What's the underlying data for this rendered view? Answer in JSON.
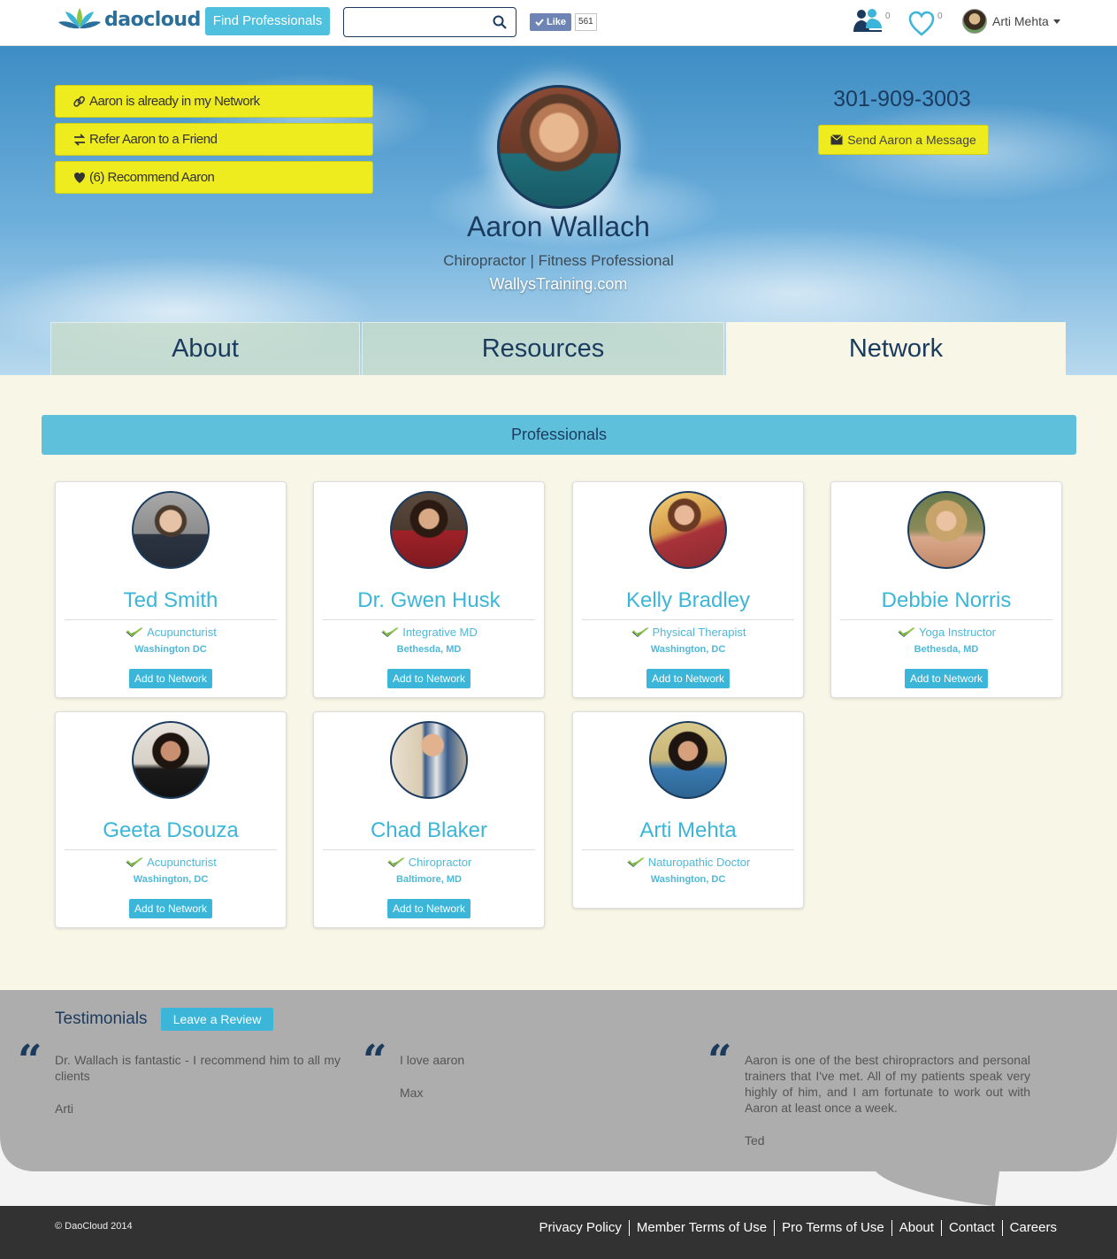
{
  "nav": {
    "logo_text": "daocloud",
    "find_label": "Find Professionals",
    "search_placeholder": "",
    "fb_like_label": "Like",
    "fb_like_count": "561",
    "network_count": "0",
    "favorites_count": "0",
    "user_name": "Arti Mehta"
  },
  "hero": {
    "actions": [
      {
        "label": "Aaron is already in my Network",
        "icon": "link-icon"
      },
      {
        "label": "Refer Aaron to a Friend",
        "icon": "exchange-icon"
      },
      {
        "label": "(6) Recommend Aaron",
        "icon": "heart-icon"
      }
    ],
    "name": "Aaron Wallach",
    "title": "Chiropractor | Fitness Professional",
    "website": "WallysTraining.com",
    "phone": "301-909-3003",
    "message_label": "Send Aaron a Message"
  },
  "tabs": [
    {
      "label": "About",
      "active": false
    },
    {
      "label": "Resources",
      "active": false
    },
    {
      "label": "Network",
      "active": true
    }
  ],
  "professionals": {
    "heading": "Professionals",
    "add_label": "Add to Network",
    "items": [
      {
        "name": "Ted Smith",
        "specialty": "Acupuncturist",
        "location": "Washington DC",
        "can_add": true
      },
      {
        "name": "Dr. Gwen Husk",
        "specialty": "Integrative MD",
        "location": "Bethesda, MD",
        "can_add": true
      },
      {
        "name": "Kelly Bradley",
        "specialty": "Physical Therapist",
        "location": "Washington, DC",
        "can_add": true
      },
      {
        "name": "Debbie Norris",
        "specialty": "Yoga Instructor",
        "location": "Bethesda, MD",
        "can_add": true
      },
      {
        "name": "Geeta Dsouza",
        "specialty": "Acupuncturist",
        "location": "Washington, DC",
        "can_add": true
      },
      {
        "name": "Chad Blaker",
        "specialty": "Chiropractor",
        "location": "Baltimore, MD",
        "can_add": true
      },
      {
        "name": "Arti Mehta",
        "specialty": "Naturopathic Doctor",
        "location": "Washington, DC",
        "can_add": false
      }
    ]
  },
  "testimonials": {
    "title": "Testimonials",
    "review_label": "Leave a Review",
    "items": [
      {
        "text": "Dr. Wallach is fantastic - I recommend him to all my clients",
        "author": "Arti"
      },
      {
        "text": "I love aaron",
        "author": "Max"
      },
      {
        "text": "Aaron is one of the best chiropractors and personal trainers that I've met. All of my patients speak very highly of him, and I am fortunate to work out with Aaron at least once a week.",
        "author": "Ted"
      }
    ]
  },
  "footer": {
    "copyright": "© DaoCloud 2014",
    "links": [
      "Privacy Policy",
      "Member Terms of Use",
      "Pro Terms of Use",
      "About",
      "Contact",
      "Careers"
    ]
  }
}
